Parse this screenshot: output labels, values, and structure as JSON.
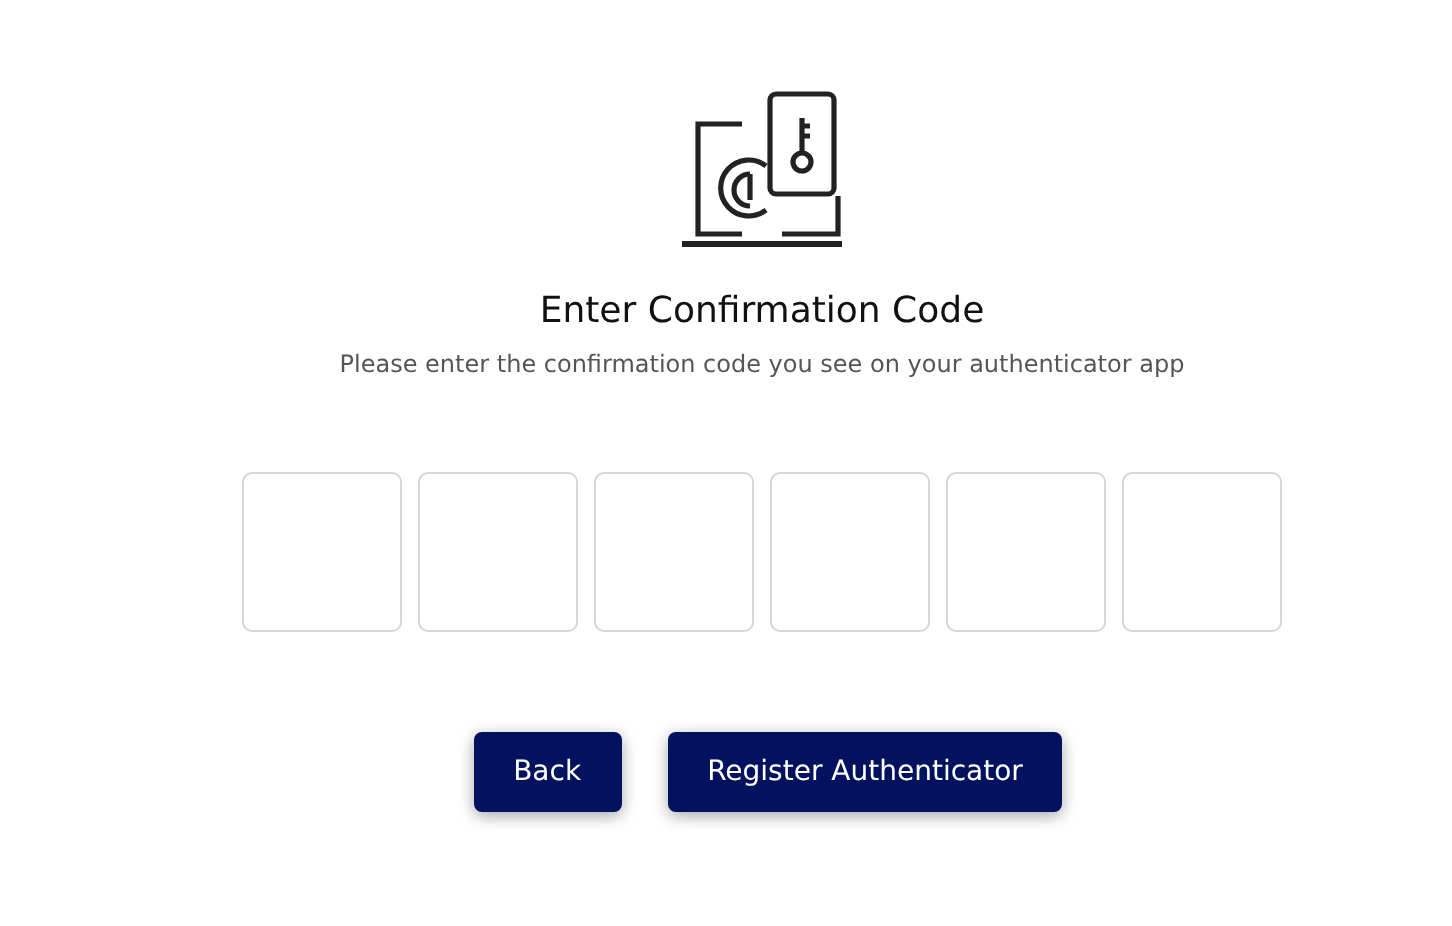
{
  "header": {
    "title": "Enter Confirmation Code",
    "subtitle": "Please enter the confirmation code you see on your authenticator app"
  },
  "code_fields": [
    {
      "kind": "digit"
    },
    {
      "kind": "digit"
    },
    {
      "kind": "digit"
    },
    {
      "kind": "digit"
    },
    {
      "kind": "digit"
    },
    {
      "kind": "digit"
    }
  ],
  "buttons": [
    {
      "label": "Back"
    },
    {
      "label": "Register Authenticator"
    }
  ]
}
